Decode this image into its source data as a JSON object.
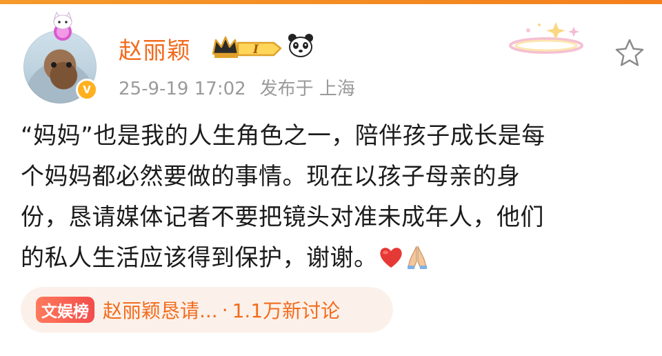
{
  "user": {
    "name": "赵丽颖",
    "verified_mark": "V",
    "vip_level": "I",
    "icons": [
      "crown-badge-icon",
      "panda-icon",
      "verified-icon",
      "star-icon"
    ]
  },
  "post": {
    "date": "25-9-19 17:02",
    "location": "发布于 上海",
    "lines": [
      "“妈妈”也是我的人生角色之一，陪伴孩子成长是每",
      "个妈妈都必然要做的事情。现在以孩子母亲的身",
      "份，恳请媒体记者不要把镜头对准未成年人，他们",
      "的私人生活应该得到保护，谢谢。"
    ],
    "trailing_emojis": [
      "heart-icon",
      "praying-hands-icon"
    ]
  },
  "trend": {
    "tag": "文娱榜",
    "title": "赵丽颖恳请...",
    "separator": "·",
    "count": "1.1万新讨论"
  },
  "colors": {
    "accent": "#f26b1d",
    "meta_gray": "#9a9a9a",
    "text": "#1b1b1b",
    "trend_bg": "#fcf1ea",
    "tag_red": "#f24c4c",
    "verified_gold": "#ffb01f"
  }
}
